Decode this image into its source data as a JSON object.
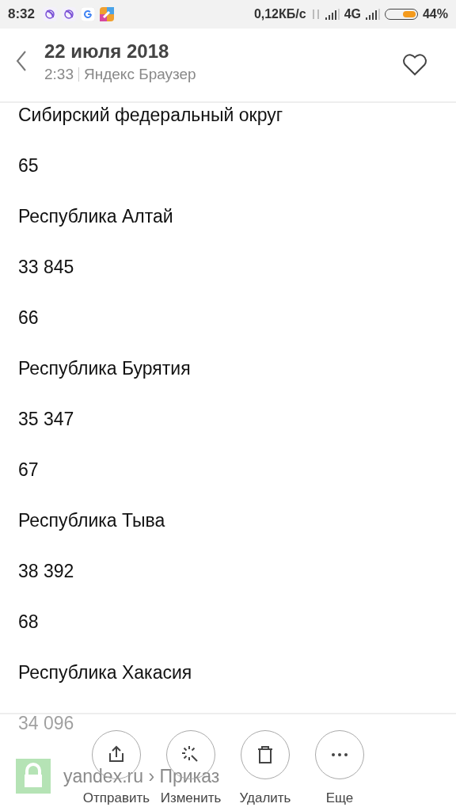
{
  "status_bar": {
    "time": "8:32",
    "speed": "0,12КБ/с",
    "network": "4G",
    "battery": {
      "level": 0.44,
      "percent": "44%"
    }
  },
  "header": {
    "title": "22 июля 2018",
    "time": "2:33",
    "source": "Яндекс Браузер",
    "favorite": false
  },
  "content": {
    "lines": [
      "Сибирский федеральный округ",
      "65",
      "Республика Алтай",
      "33 845",
      "66",
      "Республика Бурятия",
      "35 347",
      "67",
      "Республика Тыва",
      "38 392",
      "68",
      "Республика Хакасия",
      "34 096"
    ]
  },
  "browser_bar": {
    "url": "yandex.ru › Приказ"
  },
  "actions": [
    {
      "kind": "share",
      "label": "Отправить"
    },
    {
      "kind": "edit",
      "label": "Изменить"
    },
    {
      "kind": "delete",
      "label": "Удалить"
    },
    {
      "kind": "more",
      "label": "Еще"
    }
  ]
}
